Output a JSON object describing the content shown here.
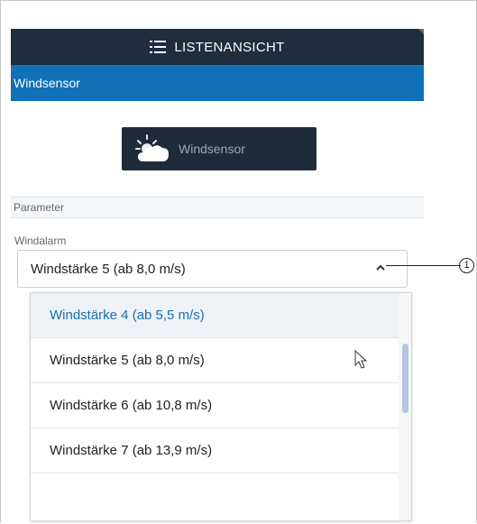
{
  "header": {
    "title": "LISTENANSICHT",
    "view_icon": "list-icon"
  },
  "panel": {
    "title": "Windsensor"
  },
  "device_button": {
    "label": "Windsensor",
    "icon": "partly-cloudy-icon"
  },
  "section": {
    "title": "Parameter"
  },
  "windalarm": {
    "label": "Windalarm",
    "selected": "Windstärke 5 (ab 8,0 m/s)",
    "options": [
      "Windstärke 4 (ab 5,5 m/s)",
      "Windstärke 5 (ab 8,0 m/s)",
      "Windstärke 6 (ab 10,8 m/s)",
      "Windstärke 7 (ab 13,9 m/s)"
    ]
  },
  "callout": {
    "number": "1"
  },
  "colors": {
    "topbar": "#1f2d3d",
    "titlebar": "#1070b8",
    "highlight_text": "#1a6fb0",
    "scroll_thumb": "#b5c6de"
  }
}
